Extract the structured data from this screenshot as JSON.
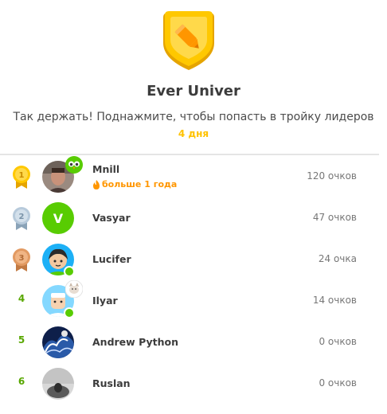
{
  "league": {
    "title": "Ever Univer",
    "subtitle": "Так держать! Поднажмите, чтобы попасть в тройку лидеров",
    "days_left": "4 дня",
    "shield_icon": "gold-shield-pencil-icon"
  },
  "colors": {
    "gold": "#f7c12b",
    "silver": "#a7bdd1",
    "bronze": "#d8935d",
    "rank_green": "#58a700",
    "streak_orange": "#ff9600",
    "online_green": "#58cc02"
  },
  "leaderboard": [
    {
      "rank": "1",
      "name": "Mnill",
      "xp": "120 очков",
      "streak": "больше 1 года",
      "medal": "gold-medal-icon",
      "badge": "owl-badge-icon",
      "online": false
    },
    {
      "rank": "2",
      "name": "Vasyar",
      "xp": "47 очков",
      "medal": "silver-medal-icon",
      "avatar_letter": "V",
      "online": false
    },
    {
      "rank": "3",
      "name": "Lucifer",
      "xp": "24 очка",
      "medal": "bronze-medal-icon",
      "online": true
    },
    {
      "rank": "4",
      "name": "Ilyar",
      "xp": "14 очков",
      "badge": "cat-badge-icon",
      "online": true
    },
    {
      "rank": "5",
      "name": "Andrew Python",
      "xp": "0 очков",
      "online": false
    },
    {
      "rank": "6",
      "name": "Ruslan",
      "xp": "0 очков",
      "online": false
    }
  ]
}
